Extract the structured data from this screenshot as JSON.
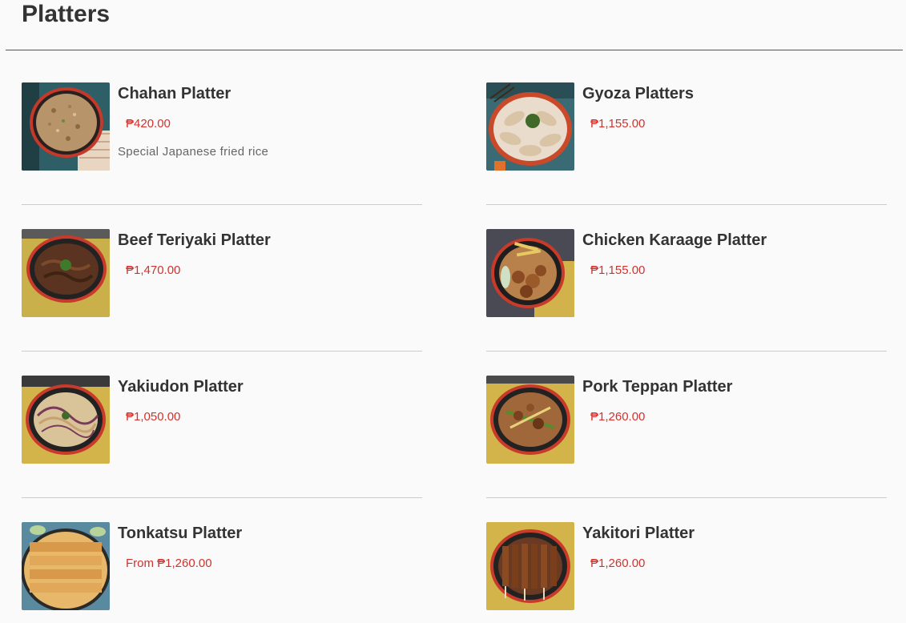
{
  "section": {
    "title": "Platters"
  },
  "items": [
    {
      "name": "Chahan Platter",
      "price": "₱420.00",
      "description": "Special Japanese fried rice",
      "image": "fried-rice-platter-image"
    },
    {
      "name": "Gyoza Platters",
      "price": "₱1,155.00",
      "description": "",
      "image": "gyoza-platter-image"
    },
    {
      "name": "Beef Teriyaki Platter",
      "price": "₱1,470.00",
      "description": "",
      "image": "beef-teriyaki-platter-image"
    },
    {
      "name": "Chicken Karaage Platter",
      "price": "₱1,155.00",
      "description": "",
      "image": "chicken-karaage-platter-image"
    },
    {
      "name": "Yakiudon Platter",
      "price": "₱1,050.00",
      "description": "",
      "image": "yakiudon-platter-image"
    },
    {
      "name": "Pork Teppan Platter",
      "price": "₱1,260.00",
      "description": "",
      "image": "pork-teppan-platter-image"
    },
    {
      "name": "Tonkatsu Platter",
      "price": "From ₱1,260.00",
      "description": "",
      "image": "tonkatsu-platter-image"
    },
    {
      "name": "Yakitori Platter",
      "price": "₱1,260.00",
      "description": "",
      "image": "yakitori-platter-image"
    }
  ],
  "colors": {
    "price": "#d2322d",
    "heading": "#333333",
    "divider": "#cccccc"
  }
}
